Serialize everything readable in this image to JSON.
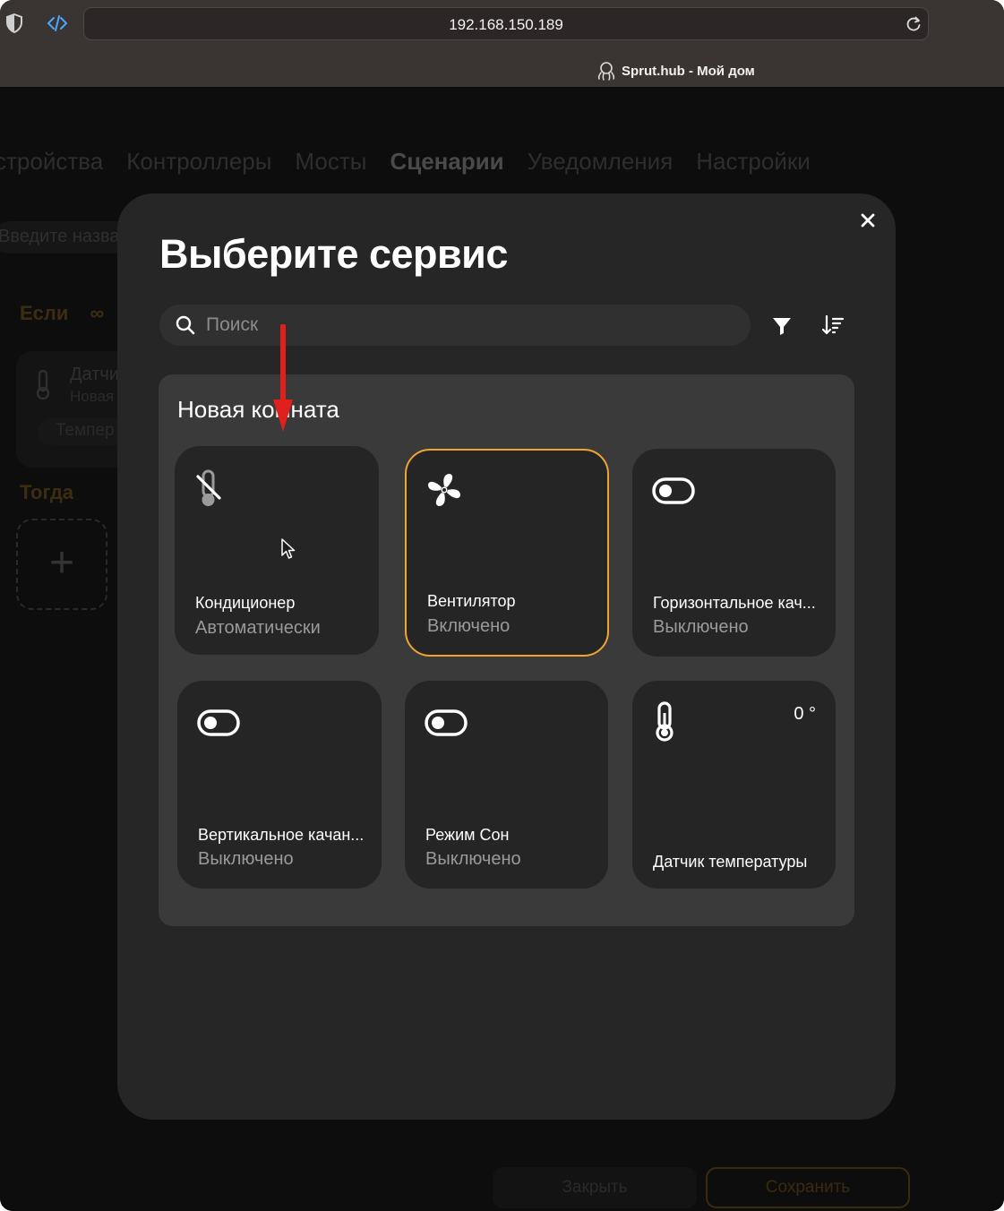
{
  "browser": {
    "url": "192.168.150.189",
    "tab_title": "Sprut.hub - Мой дом"
  },
  "background_page": {
    "nav": [
      "стройства",
      "Контроллеры",
      "Мосты",
      "Сценарии",
      "Уведомления",
      "Настройки"
    ],
    "active_nav": "Сценарии",
    "search_placeholder": "Введите назван",
    "if_label": "Если",
    "then_label": "Тогда",
    "sensor_name": "Датчи",
    "sensor_room": "Новая",
    "sensor_chip": "Темпер",
    "close_button": "Закрыть",
    "save_button": "Сохранить"
  },
  "modal": {
    "title": "Выберите сервис",
    "search_placeholder": "Поиск",
    "room": {
      "title": "Новая комната",
      "services": [
        {
          "name": "Кондиционер",
          "state": "Автоматически",
          "icon": "ac-off-icon",
          "selected": false,
          "value": ""
        },
        {
          "name": "Вентилятор",
          "state": "Включено",
          "icon": "fan-icon",
          "selected": true,
          "value": ""
        },
        {
          "name": "Горизонтальное кач...",
          "state": "Выключено",
          "icon": "toggle-icon",
          "selected": false,
          "value": ""
        },
        {
          "name": "Вертикальное качан...",
          "state": "Выключено",
          "icon": "toggle-icon",
          "selected": false,
          "value": ""
        },
        {
          "name": "Режим Сон",
          "state": "Выключено",
          "icon": "toggle-icon",
          "selected": false,
          "value": ""
        },
        {
          "name": "Датчик температуры",
          "state": "",
          "icon": "thermometer-icon",
          "selected": false,
          "value": "0 °"
        }
      ]
    }
  },
  "colors": {
    "accent": "#f0a432",
    "annotation_arrow": "#e0201c",
    "modal_bg": "#262626",
    "room_bg": "#3a3a3a",
    "tile_bg": "#252525"
  }
}
